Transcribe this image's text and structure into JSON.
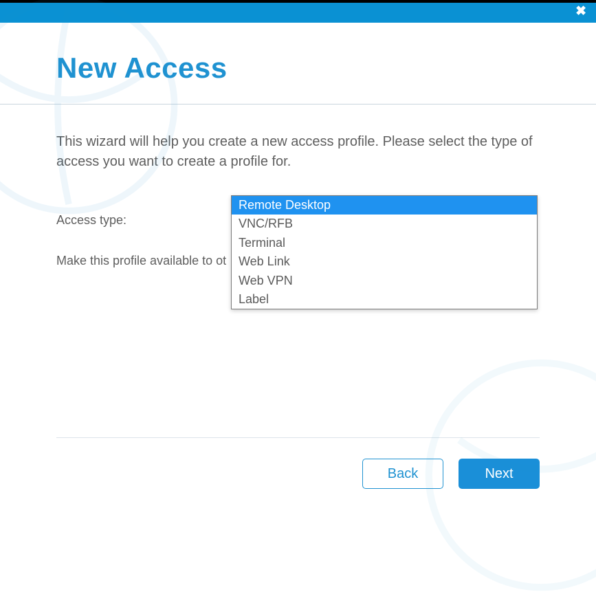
{
  "dialog": {
    "title": "New Access",
    "description": "This wizard will help you create a new access profile. Please select the type of access you want to create a profile for."
  },
  "form": {
    "access_type_label": "Access type:",
    "access_type_selected": "Remote Desktop",
    "access_type_options": [
      "Remote Desktop",
      "VNC/RFB",
      "Terminal",
      "Web Link",
      "Web VPN",
      "Label"
    ],
    "share_label_partial": "Make this profile available to ot"
  },
  "footer": {
    "back_label": "Back",
    "next_label": "Next"
  }
}
